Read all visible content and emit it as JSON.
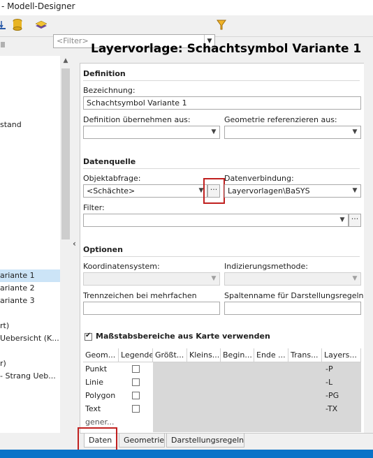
{
  "window": {
    "title": "- Modell-Designer"
  },
  "toolbar": {
    "filter_placeholder": "<Filter>"
  },
  "tree": {
    "items": [
      {
        "label": "stand",
        "selected": false
      },
      {
        "label": "ariante 1",
        "selected": true
      },
      {
        "label": "ariante 2",
        "selected": false
      },
      {
        "label": "ariante 3",
        "selected": false
      },
      {
        "label": "rt)",
        "selected": false
      },
      {
        "label": " Uebersicht (K...",
        "selected": false
      },
      {
        "label": "r)",
        "selected": false
      },
      {
        "label": " - Strang Ueb...",
        "selected": false
      }
    ]
  },
  "page": {
    "heading": "Layervorlage: Schachtsymbol Variante 1"
  },
  "definition": {
    "section_title": "Definition",
    "bezeichnung_label": "Bezeichnung:",
    "bezeichnung_value": "Schachtsymbol Variante 1",
    "uebernehmen_label": "Definition übernehmen aus:",
    "geometrie_label": "Geometrie referenzieren aus:"
  },
  "datenquelle": {
    "section_title": "Datenquelle",
    "objektabfrage_label": "Objektabfrage:",
    "objektabfrage_value": "<Schächte>",
    "ellipsis": "···",
    "datenverbindung_label": "Datenverbindung:",
    "datenverbindung_value": "Layervorlagen\\BaSYS",
    "filter_label": "Filter:"
  },
  "optionen": {
    "section_title": "Optionen",
    "koordinatensystem_label": "Koordinatensystem:",
    "indizierung_label": "Indizierungsmethode:",
    "trennzeichen_label": "Trennzeichen bei mehrfachen",
    "spaltenname_label": "Spaltenname für Darstellungsregeln:"
  },
  "massstab": {
    "checkbox_label": "Maßstabsbereiche aus Karte verwenden",
    "checked": true,
    "columns": [
      "Geom...",
      "Legende",
      "Größt...",
      "Kleins...",
      "Begin...",
      "Ende ...",
      "Trans...",
      "Layers..."
    ],
    "rows": [
      {
        "geom": "Punkt",
        "layer": "-P"
      },
      {
        "geom": "Linie",
        "layer": "-L"
      },
      {
        "geom": "Polygon",
        "layer": "-PG"
      },
      {
        "geom": "Text",
        "layer": "-TX"
      },
      {
        "geom": "gener...",
        "layer": ""
      }
    ]
  },
  "tabs": [
    {
      "label": "Daten",
      "active": true
    },
    {
      "label": "Geometrie",
      "active": false
    },
    {
      "label": "Darstellungsregeln",
      "active": false
    }
  ],
  "colors": {
    "accent": "#0a73c8",
    "highlight_box": "#c0201f",
    "selection": "#cce4f7"
  }
}
